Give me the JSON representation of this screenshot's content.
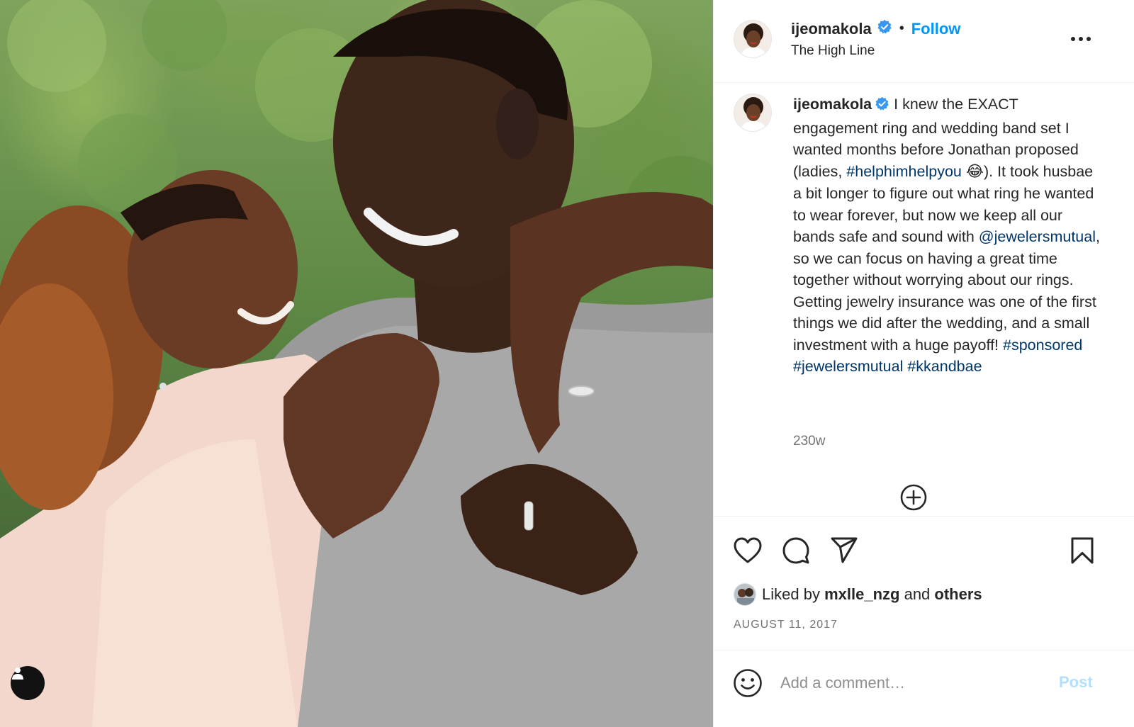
{
  "colors": {
    "accent": "#0095f6",
    "verified": "#3897f0",
    "hashtag": "#00376b",
    "muted": "#737373",
    "post_disabled": "#b2dffc"
  },
  "photo": {
    "user_button_icon": "person-icon"
  },
  "header": {
    "username": "ijeomakola",
    "verified_icon": "verified-badge-icon",
    "separator": "•",
    "follow_label": "Follow",
    "location": "The High Line",
    "more_icon": "more-options-icon"
  },
  "caption": {
    "username": "ijeomakola",
    "text_1": "I knew the EXACT engagement ring and wedding band set I wanted months before Jonathan proposed (ladies, ",
    "hashtag_1": "#helphimhelpyou",
    "emoji": "😂",
    "text_2": "). It took husbae a bit longer to figure out what ring he wanted to wear forever, but now we keep all our bands safe and sound with ",
    "mention": "@jewelersmutual",
    "text_3": ", so we can focus on having a great time together without worrying about our rings. Getting jewelry insurance was one of the first things we did after the wedding, and a small investment with a huge payoff! ",
    "hashtag_2": "#sponsored",
    "hashtag_3": "#jewelersmutual",
    "hashtag_4": "#kkandbae",
    "time_ago": "230w"
  },
  "actions": {
    "like_icon": "heart-icon",
    "comment_icon": "comment-icon",
    "share_icon": "share-icon",
    "save_icon": "bookmark-icon",
    "liked_prefix": "Liked by",
    "liked_user": "mxlle_nzg",
    "liked_and": "and",
    "liked_others": "others",
    "date": "AUGUST 11, 2017"
  },
  "comment": {
    "emoji_icon": "smiley-icon",
    "placeholder": "Add a comment…",
    "post_label": "Post"
  }
}
